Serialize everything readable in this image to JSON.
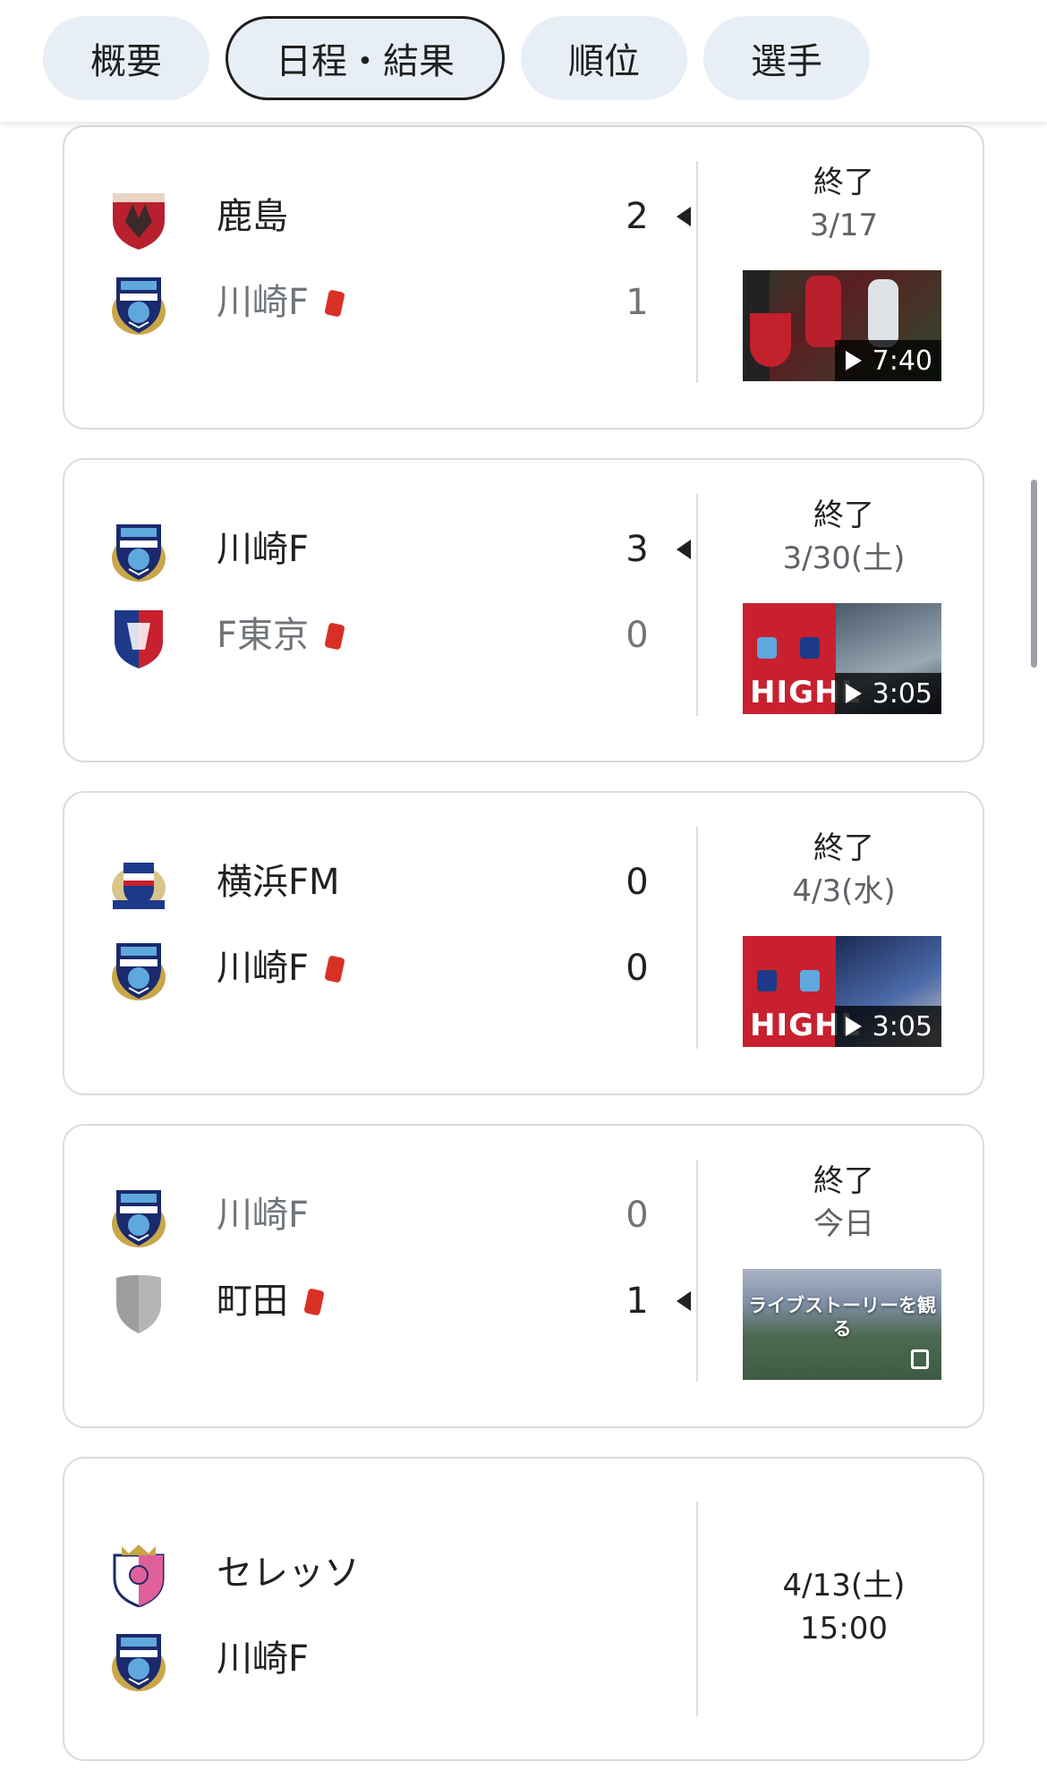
{
  "tabs": [
    {
      "label": "概要",
      "active": false
    },
    {
      "label": "日程・結果",
      "active": true
    },
    {
      "label": "順位",
      "active": false
    },
    {
      "label": "選手",
      "active": false
    }
  ],
  "matches": [
    {
      "home": {
        "name": "鹿島",
        "score": "2",
        "logo": "kashima-crest-icon"
      },
      "away": {
        "name": "川崎F",
        "score": "1",
        "logo": "kawasaki-crest-icon"
      },
      "status": "終了",
      "date": "3/17",
      "video_duration": "7:40"
    },
    {
      "home": {
        "name": "川崎F",
        "score": "3",
        "logo": "kawasaki-crest-icon"
      },
      "away": {
        "name": "F東京",
        "score": "0",
        "logo": "fc-tokyo-crest-icon"
      },
      "status": "終了",
      "date": "3/30(土)",
      "video_duration": "3:05",
      "thumb_text": "HIGHL"
    },
    {
      "home": {
        "name": "横浜FM",
        "score": "0",
        "logo": "yokohama-fm-crest-icon"
      },
      "away": {
        "name": "川崎F",
        "score": "0",
        "logo": "kawasaki-crest-icon"
      },
      "status": "終了",
      "date": "4/3(水)",
      "video_duration": "3:05",
      "thumb_text": "HIGHL"
    },
    {
      "home": {
        "name": "川崎F",
        "score": "0",
        "logo": "kawasaki-crest-icon"
      },
      "away": {
        "name": "町田",
        "score": "1",
        "logo": "generic-shield-icon"
      },
      "status": "終了",
      "date": "今日",
      "story_label": "ライブストーリーを観る"
    },
    {
      "home": {
        "name": "セレッソ",
        "logo": "cerezo-crest-icon"
      },
      "away": {
        "name": "川崎F",
        "logo": "kawasaki-crest-icon"
      },
      "date": "4/13(土)",
      "time": "15:00"
    }
  ],
  "colors": {
    "red_card": "#d93025",
    "tab_bg": "#e8eef6",
    "card_border": "#dadce0"
  }
}
